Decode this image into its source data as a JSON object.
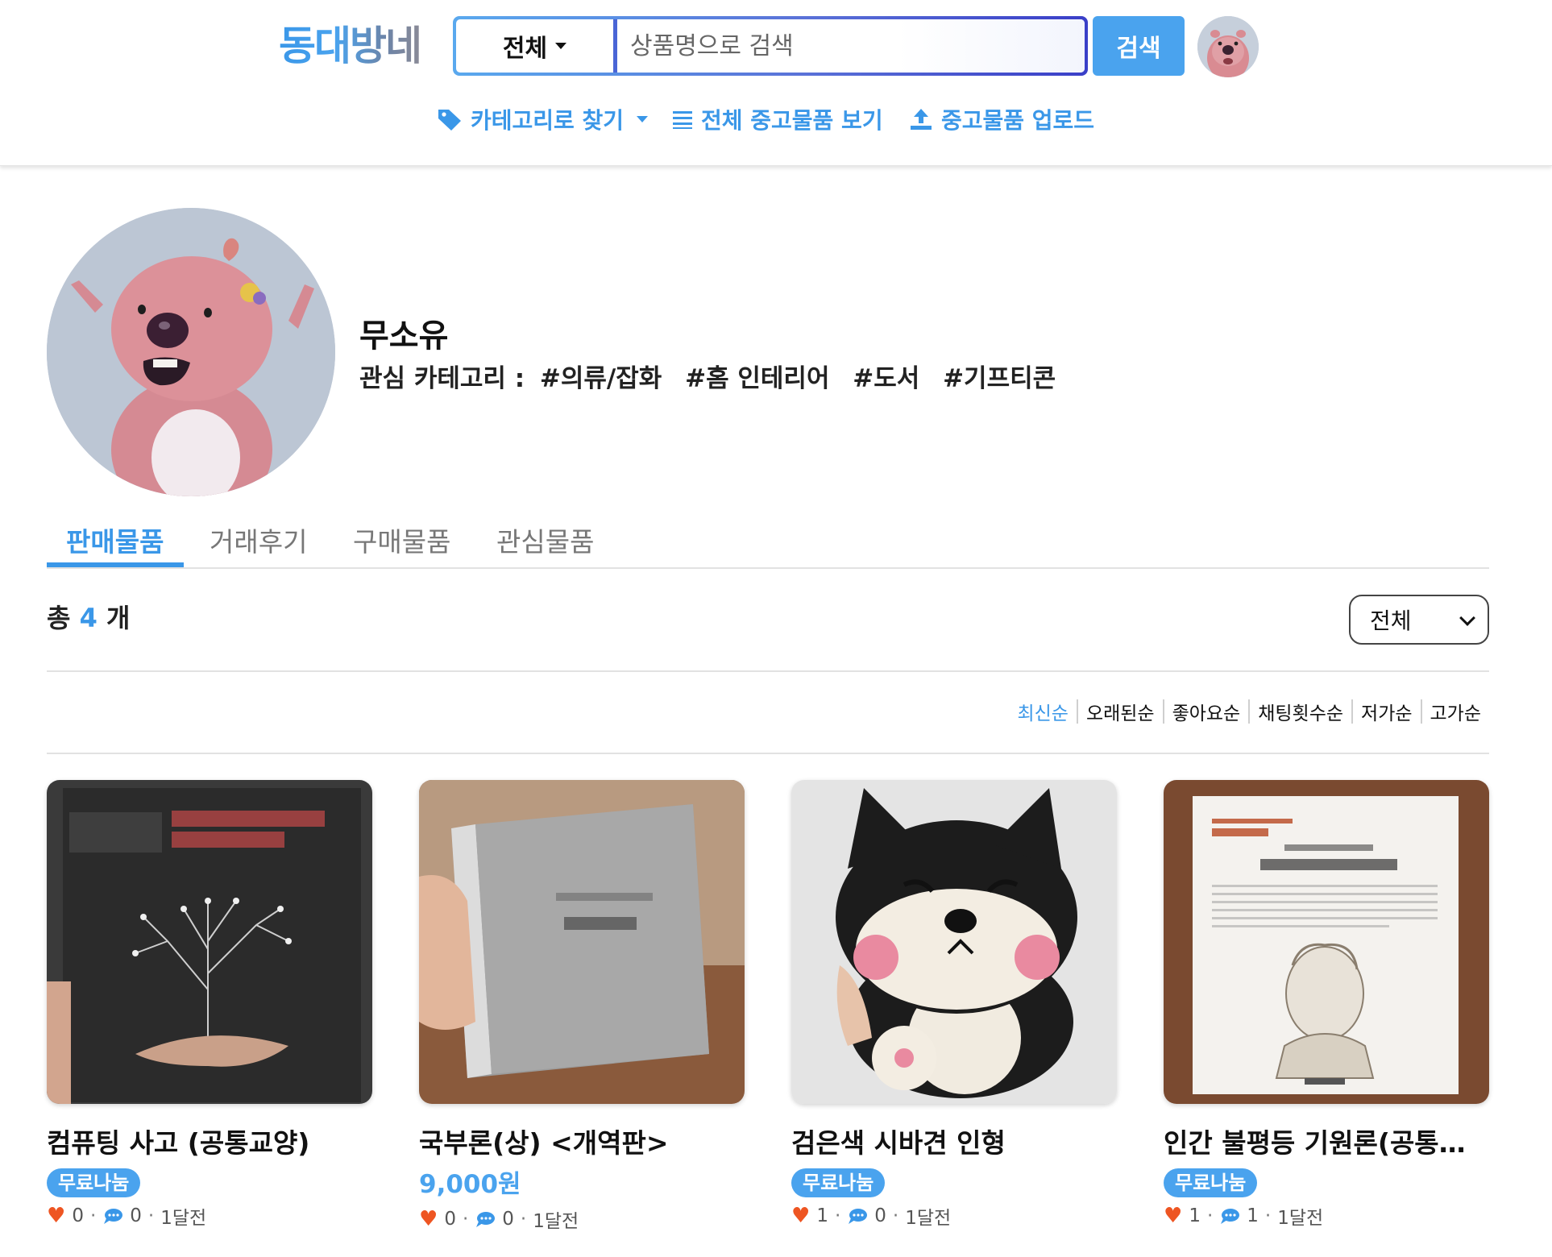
{
  "header": {
    "logo": "동대방네",
    "category_select": "전체",
    "search_placeholder": "상품명으로 검색",
    "search_button": "검색",
    "nav": {
      "category": "카테고리로 찾기",
      "all_items": "전체 중고물품 보기",
      "upload": "중고물품 업로드"
    }
  },
  "profile": {
    "name": "무소유",
    "interest_label": "관심 카테고리 :",
    "interests": [
      "#의류/잡화",
      "#홈 인테리어",
      "#도서",
      "#기프티콘"
    ]
  },
  "tabs": [
    "판매물품",
    "거래후기",
    "구매물품",
    "관심물품"
  ],
  "summary": {
    "prefix": "총",
    "count": "4",
    "suffix": "개",
    "filter_value": "전체"
  },
  "sort_options": [
    "최신순",
    "오래된순",
    "좋아요순",
    "채팅횟수순",
    "저가순",
    "고가순"
  ],
  "items": [
    {
      "title": "컴퓨팅 사고 (공통교양)",
      "price": "",
      "badge": "무료나눔",
      "likes": "0",
      "chats": "0",
      "time": "1달전"
    },
    {
      "title": "국부론(상) <개역판>",
      "price": "9,000원",
      "badge": "",
      "likes": "0",
      "chats": "0",
      "time": "1달전"
    },
    {
      "title": "검은색 시바견 인형",
      "price": "",
      "badge": "무료나눔",
      "likes": "1",
      "chats": "0",
      "time": "1달전"
    },
    {
      "title": "인간 불평등 기원론(공통교양)",
      "price": "",
      "badge": "무료나눔",
      "likes": "1",
      "chats": "1",
      "time": "1달전"
    }
  ],
  "colors": {
    "accent": "#4aa3ee",
    "heart": "#ee5522"
  }
}
